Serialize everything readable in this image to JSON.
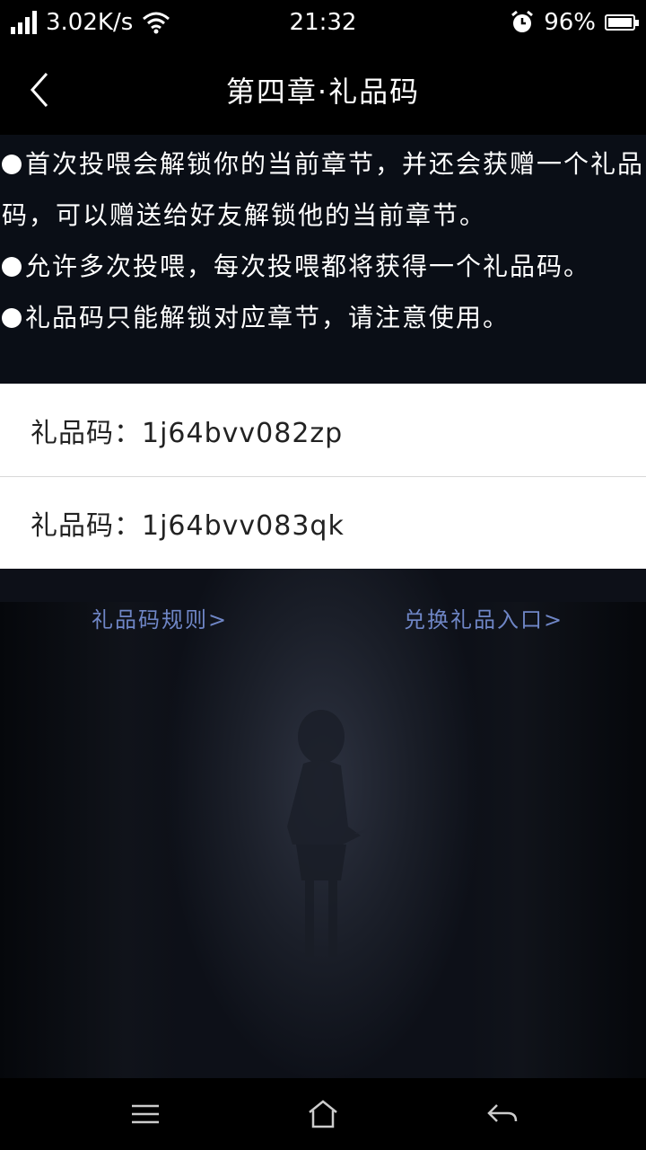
{
  "status_bar": {
    "speed": "3.02K/s",
    "time": "21:32",
    "battery": "96%",
    "battery_level": 0.96,
    "icons": [
      "signal-icon",
      "wifi-icon",
      "alarm-icon",
      "battery-icon"
    ]
  },
  "header": {
    "title": "第四章·礼品码",
    "back_icon": "chevron-left-icon"
  },
  "rules": [
    "首次投喂会解锁你的当前章节，并还会获赠一个礼品码，可以赠送给好友解锁他的当前章节。",
    "允许多次投喂，每次投喂都将获得一个礼品码。",
    "礼品码只能解锁对应章节，请注意使用。"
  ],
  "codes": [
    "礼品码：1j64bvv082zp",
    "礼品码：1j64bvv083qk"
  ],
  "links": {
    "rules": "礼品码规则>",
    "exchange": "兑换礼品入口>"
  },
  "colors": {
    "link": "#6f86c6",
    "background": "#0b0e15"
  },
  "nav": {
    "icons": [
      "menu-icon",
      "home-icon",
      "back-arrow-icon"
    ]
  }
}
